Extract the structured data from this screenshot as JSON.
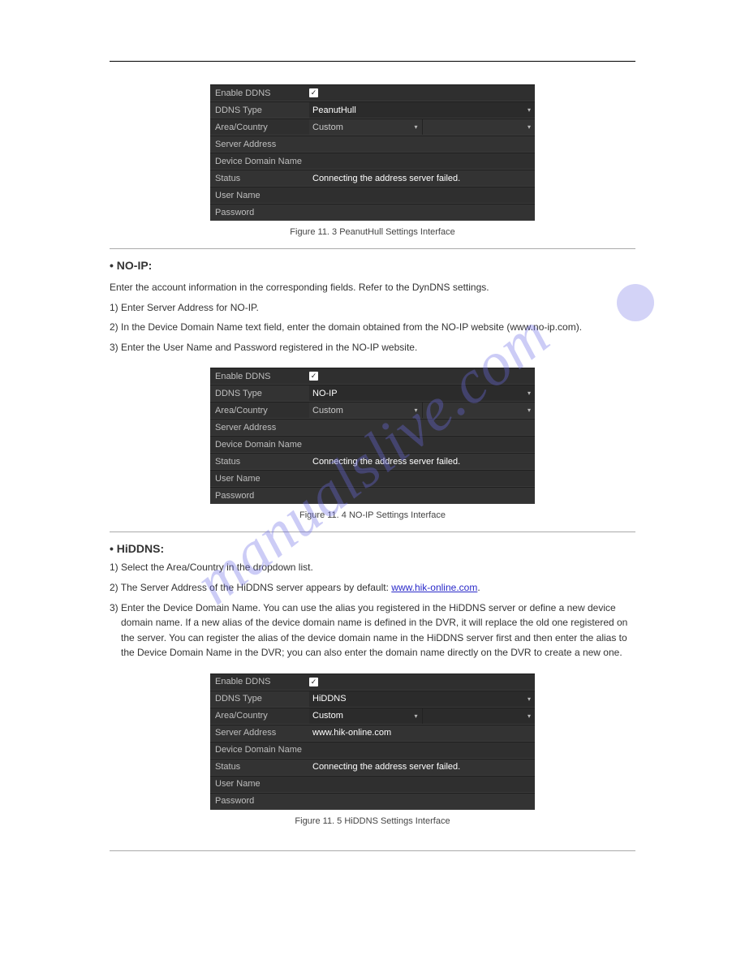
{
  "watermark": "manualslive.com",
  "panel1": {
    "fig": "Figure 11. 3 PeanutHull Settings Interface",
    "labels": {
      "enable": "Enable DDNS",
      "type": "DDNS Type",
      "area": "Area/Country",
      "server": "Server Address",
      "domain": "Device Domain Name",
      "status": "Status",
      "user": "User Name",
      "pass": "Password"
    },
    "values": {
      "type": "PeanutHull",
      "area": "Custom",
      "sub": "",
      "server": "",
      "domain": "",
      "status": "Connecting the address server failed.",
      "user": "",
      "pass": ""
    }
  },
  "section_noip": {
    "title": "• NO-IP:",
    "intro": "Enter the account information in the corresponding fields. Refer to the DynDNS settings.",
    "steps": [
      "1) Enter Server Address for NO-IP.",
      "2) In the Device Domain Name text field, enter the domain obtained from the NO-IP website (www.no-ip.com).",
      "3) Enter the User Name and Password registered in the NO-IP website."
    ]
  },
  "panel2": {
    "fig": "Figure 11. 4 NO-IP Settings Interface",
    "labels": {
      "enable": "Enable DDNS",
      "type": "DDNS Type",
      "area": "Area/Country",
      "server": "Server Address",
      "domain": "Device Domain Name",
      "status": "Status",
      "user": "User Name",
      "pass": "Password"
    },
    "values": {
      "type": "NO-IP",
      "area": "Custom",
      "sub": "",
      "server": "",
      "domain": "",
      "status": "Connecting the address server failed.",
      "user": "",
      "pass": ""
    }
  },
  "section_hiddns": {
    "title": "• HiDDNS:",
    "steps": [
      "1) Select the Area/Country in the dropdown list.",
      "2) The Server Address of the HiDDNS server appears by default: ",
      "3) Enter the Device Domain Name. You can use the alias you registered in the HiDDNS server or define a new device domain name. If a new alias of the device domain name is defined in the DVR, it will replace the old one registered on the server. You can register the alias of the device domain name in the HiDDNS server first and then enter the alias to the Device Domain Name in the DVR; you can also enter the domain name directly on the DVR to create a new one."
    ],
    "link": "www.hik-online.com"
  },
  "panel3": {
    "fig": "Figure 11. 5 HiDDNS Settings Interface",
    "labels": {
      "enable": "Enable DDNS",
      "type": "DDNS Type",
      "area": "Area/Country",
      "server": "Server Address",
      "domain": "Device Domain Name",
      "status": "Status",
      "user": "User Name",
      "pass": "Password"
    },
    "values": {
      "type": "HiDDNS",
      "area": "Custom",
      "sub": "",
      "server": "www.hik-online.com",
      "domain": "",
      "status": "Connecting the address server failed.",
      "user": "",
      "pass": ""
    }
  }
}
